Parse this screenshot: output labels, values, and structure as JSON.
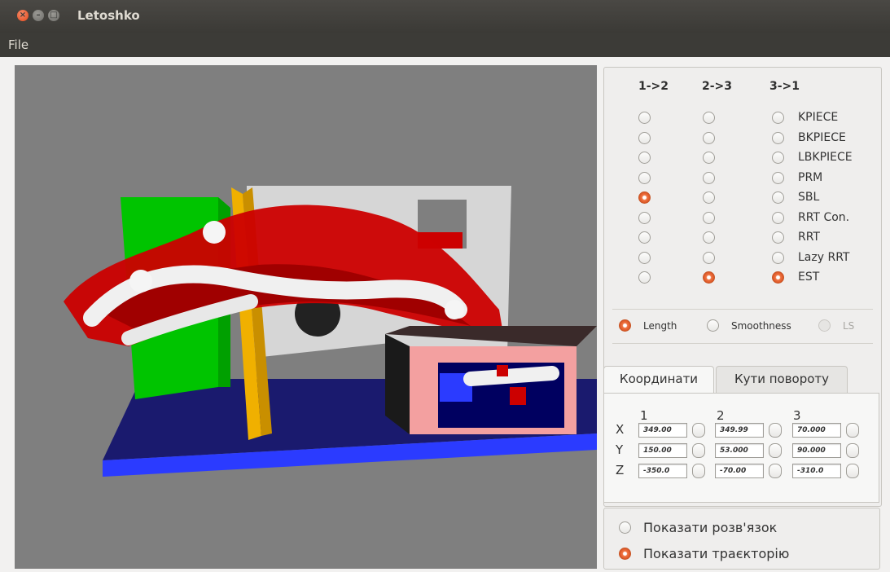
{
  "window": {
    "title": "Letoshko"
  },
  "menu": {
    "file": "File"
  },
  "planner": {
    "columns": [
      "1->2",
      "2->3",
      "3->1"
    ],
    "algorithms": [
      "KPIECE",
      "BKPIECE",
      "LBKPIECE",
      "PRM",
      "SBL",
      "RRT Con.",
      "RRT",
      "Lazy RRT",
      "EST"
    ],
    "selected": {
      "col1": "SBL",
      "col2": "EST",
      "col3": "EST"
    }
  },
  "optimization": {
    "options": [
      "Length",
      "Smoothness",
      "LS"
    ],
    "selected": "Length",
    "disabled": [
      "LS"
    ]
  },
  "tabs": {
    "coordinates": "Координати",
    "angles": "Кути повороту",
    "active": "coordinates"
  },
  "coords": {
    "headers": [
      "1",
      "2",
      "3"
    ],
    "axes": [
      "X",
      "Y",
      "Z"
    ],
    "X": [
      "349.00",
      "349.99",
      "70.000"
    ],
    "Y": [
      "150.00",
      "53.000",
      "90.000"
    ],
    "Z": [
      "-350.0",
      "-70.00",
      "-310.0"
    ]
  },
  "display": {
    "show_solution": "Показати розв'язок",
    "show_trajectory": "Показати траєкторію",
    "selected": "show_trajectory"
  },
  "colors": {
    "background": "#7f7f7f",
    "base": "#1a1a6e",
    "base_edge": "#2b3bff",
    "green_block": "#00c400",
    "orange_pole": "#f0b000",
    "wall": "#d6d6d6",
    "robot": "#cc0000",
    "link": "#f0f0f0",
    "box_frame": "#f3a0a0",
    "box_top": "#3a2a2a",
    "accent": "#e2491b"
  }
}
